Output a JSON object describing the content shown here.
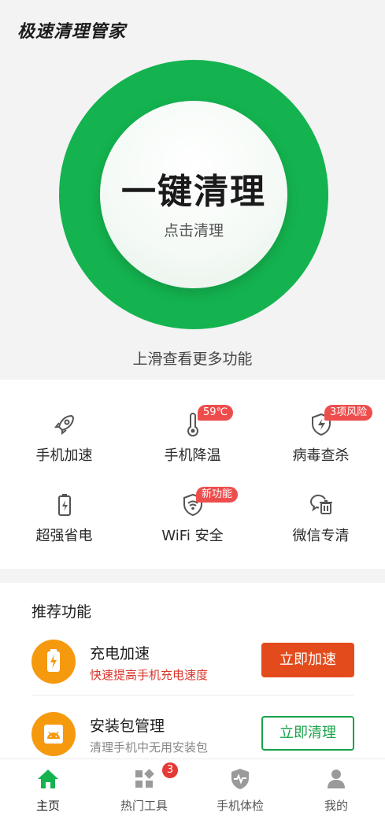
{
  "app": {
    "title": "极速清理管家"
  },
  "hero": {
    "main_label": "一键清理",
    "sub_label": "点击清理",
    "swipe_hint": "上滑查看更多功能"
  },
  "tools": [
    {
      "label": "手机加速",
      "icon": "rocket-icon",
      "badge": ""
    },
    {
      "label": "手机降温",
      "icon": "thermometer-icon",
      "badge": "59℃"
    },
    {
      "label": "病毒查杀",
      "icon": "shield-icon",
      "badge": "3项风险"
    },
    {
      "label": "超强省电",
      "icon": "battery-icon",
      "badge": ""
    },
    {
      "label": "WiFi 安全",
      "icon": "wifi-shield-icon",
      "badge": "新功能"
    },
    {
      "label": "微信专清",
      "icon": "chat-trash-icon",
      "badge": ""
    }
  ],
  "recommend": {
    "title": "推荐功能",
    "items": [
      {
        "name": "充电加速",
        "desc": "快速提高手机充电速度",
        "button": "立即加速",
        "icon": "charging-battery-icon",
        "desc_color": "#d9362b"
      },
      {
        "name": "安装包管理",
        "desc": "清理手机中无用安装包",
        "button": "立即清理",
        "icon": "android-box-icon",
        "desc_color": "#888888"
      }
    ]
  },
  "tabbar": {
    "tabs": [
      {
        "label": "主页",
        "icon": "home-icon",
        "active": true
      },
      {
        "label": "热门工具",
        "icon": "apps-icon",
        "badge": "3"
      },
      {
        "label": "手机体检",
        "icon": "shield-pulse-icon"
      },
      {
        "label": "我的",
        "icon": "profile-icon"
      }
    ]
  },
  "colors": {
    "brand_green": "#14b34f",
    "accent_orange": "#f59a0e",
    "button_red": "#e34b1c",
    "badge_red": "#ee4d4d"
  }
}
